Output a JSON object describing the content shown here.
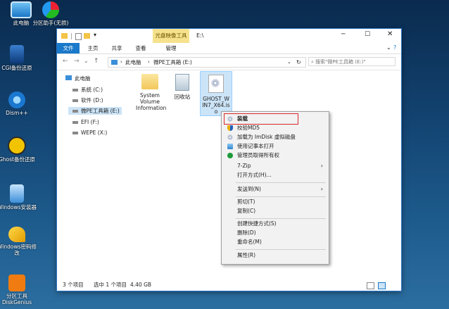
{
  "desktop": {
    "icons": [
      {
        "label": "此电脑",
        "icon": "computer-icon"
      },
      {
        "label": "分区助手(无损)",
        "icon": "partition-assistant-icon"
      },
      {
        "label": "CGI备份还原",
        "icon": "cgi-backup-icon"
      },
      {
        "label": "Dism++",
        "icon": "dism-gear-icon"
      },
      {
        "label": "Ghost备份还原",
        "icon": "ghost-icon"
      },
      {
        "label": "Windows安装器",
        "icon": "windows-installer-icon"
      },
      {
        "label": "Windows密码修改",
        "icon": "key-icon"
      },
      {
        "label": "分区工具DiskGenius",
        "icon": "diskgenius-icon"
      }
    ]
  },
  "window": {
    "context_tab": "光盘映像工具",
    "title": "E:\\",
    "ribbon_tabs": [
      "文件",
      "主页",
      "共享",
      "查看",
      "管理"
    ],
    "address_path": [
      "此电脑",
      "微PE工具箱 (E:)"
    ],
    "search_placeholder": "搜索\"微PE工具箱 (E:)\"",
    "nav": [
      {
        "label": "此电脑"
      },
      {
        "label": "系统 (C:)"
      },
      {
        "label": "软件 (D:)"
      },
      {
        "label": "微PE工具箱 (E:)"
      },
      {
        "label": "EFI (F:)"
      },
      {
        "label": "WEPE (X:)"
      }
    ],
    "files": [
      {
        "name": "System Volume Information",
        "l1": "System",
        "l2": "Volume",
        "l3": "Information",
        "icon": "folder-icon"
      },
      {
        "name": "回收站",
        "icon": "recycle-bin-icon"
      },
      {
        "name": "GHOST_WIN7_X64.iso",
        "l1": "GHOST_W",
        "l2": "IN7_X64.is",
        "l3": "o",
        "icon": "disc-image-icon"
      }
    ],
    "status": {
      "count": "3 个项目",
      "selected": "选中 1 个项目",
      "size": "4.40 GB"
    }
  },
  "context_menu": {
    "items": [
      {
        "label": "装载",
        "icon": "disc-icon",
        "highlight": true
      },
      {
        "label": "校验MD5",
        "icon": "shield-icon"
      },
      {
        "label": "加载为 ImDisk 虚拟磁盘",
        "icon": "disc-icon"
      },
      {
        "label": "使用记事本打开",
        "icon": "notepad-icon"
      },
      {
        "label": "管理员取得所有权",
        "icon": "shield-check-icon"
      },
      {
        "label": "7-Zip",
        "submenu": true
      },
      {
        "label": "打开方式(H)..."
      },
      {
        "label": "发送到(N)",
        "submenu": true
      },
      {
        "label": "剪切(T)"
      },
      {
        "label": "复制(C)"
      },
      {
        "label": "创建快捷方式(S)"
      },
      {
        "label": "删除(D)"
      },
      {
        "label": "重命名(M)"
      },
      {
        "label": "属性(R)"
      }
    ]
  },
  "colors": {
    "accent": "#2b77c7",
    "highlight_border": "#d9262b",
    "context_tab": "#f6e28c"
  }
}
